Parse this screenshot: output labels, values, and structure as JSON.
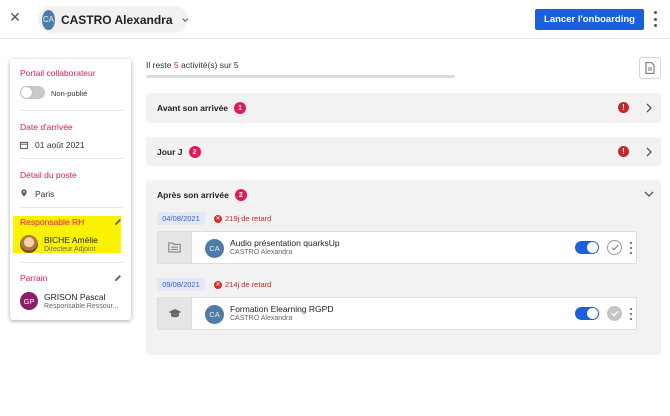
{
  "header": {
    "close_glyph": "✕",
    "user_initials": "CA",
    "user_name": "CASTRO Alexandra",
    "launch_button": "Lancer l'onboarding"
  },
  "left_panel": {
    "portal": {
      "title": "Portail collaborateur",
      "toggle_label": "Non-publié"
    },
    "arrival": {
      "title": "Date d'arrivée",
      "value": "01 août 2021"
    },
    "position": {
      "title": "Détail du poste",
      "value": "Paris"
    },
    "hr": {
      "title": "Responsable RH",
      "name": "BICHE Amélie",
      "role": "Directeur Adjoint"
    },
    "sponsor": {
      "title": "Parrain",
      "initials": "GP",
      "name": "GRISON Pascal",
      "role": "Responsable Ressour..."
    }
  },
  "progress": {
    "prefix": "Il reste",
    "remaining": "5",
    "suffix": "activité(s) sur 5",
    "fraction_done": 0
  },
  "sections": [
    {
      "title": "Avant son arrivée",
      "count": "1",
      "warn": "!"
    },
    {
      "title": "Jour J",
      "count": "2",
      "warn": "!"
    },
    {
      "title": "Après son arrivée",
      "count": "2"
    }
  ],
  "activities": [
    {
      "date": "04/08/2021",
      "late": "219j de retard",
      "avatar": "CA",
      "title": "Audio présentation quarksUp",
      "assignee": "CASTRO Alexandra"
    },
    {
      "date": "09/08/2021",
      "late": "214j de retard",
      "avatar": "CA",
      "title": "Formation Elearning RGPD",
      "assignee": "CASTRO Alexandra"
    }
  ],
  "colors": {
    "accent": "#e2185a",
    "primary": "#1a5fde",
    "danger": "#c62828",
    "highlight": "#faf200"
  }
}
